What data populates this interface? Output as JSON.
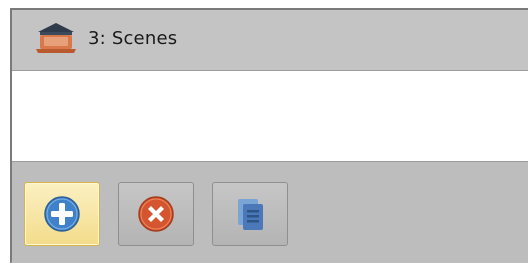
{
  "panel": {
    "title": "3: Scenes",
    "title_icon": "scene-theater-icon"
  },
  "toolbar": {
    "buttons": [
      {
        "name": "add-scene-button",
        "icon": "plus-circle-icon",
        "state": "active"
      },
      {
        "name": "remove-scene-button",
        "icon": "x-circle-icon",
        "state": "normal"
      },
      {
        "name": "duplicate-scene-button",
        "icon": "copy-icon",
        "state": "normal"
      }
    ]
  },
  "colors": {
    "frame_background": "#bdbdbd",
    "content_background": "#ffffff",
    "active_button": "#f3dc8a",
    "add_icon": "#3f82c9",
    "remove_icon": "#d4552e",
    "duplicate_icon": "#4a78b8"
  }
}
